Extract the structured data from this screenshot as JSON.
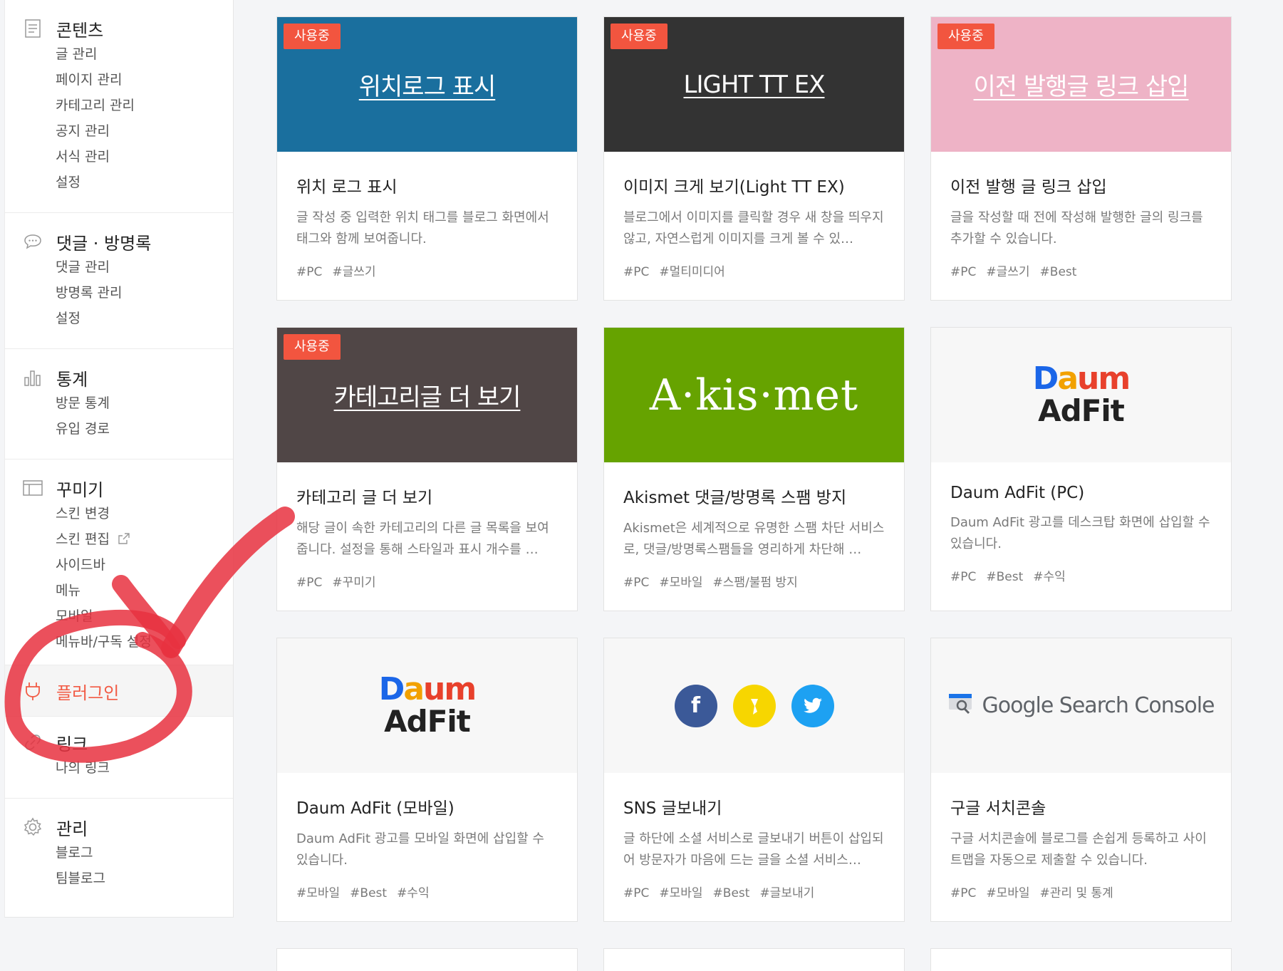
{
  "sidebar": {
    "content": {
      "title": "콘텐츠",
      "items": [
        "글 관리",
        "페이지 관리",
        "카테고리 관리",
        "공지 관리",
        "서식 관리",
        "설정"
      ]
    },
    "comments": {
      "title": "댓글 · 방명록",
      "items": [
        "댓글 관리",
        "방명록 관리",
        "설정"
      ]
    },
    "stats": {
      "title": "통계",
      "items": [
        "방문 통계",
        "유입 경로"
      ]
    },
    "design": {
      "title": "꾸미기",
      "items": [
        "스킨 변경",
        "스킨 편집",
        "사이드바",
        "메뉴",
        "모바일",
        "메뉴바/구독 설정"
      ]
    },
    "plugin": {
      "title": "플러그인"
    },
    "link": {
      "title": "링크",
      "items": [
        "나의 링크"
      ]
    },
    "manage": {
      "title": "관리",
      "items": [
        "블로그",
        "팀블로그"
      ]
    }
  },
  "cards": [
    {
      "badge": "사용중",
      "thumb_text": "위치로그 표시",
      "title": "위치 로그 표시",
      "desc": "글 작성 중 입력한 위치 태그를 블로그 화면에서 태그와 함께 보여줍니다.",
      "tags": [
        "#PC",
        "#글쓰기"
      ]
    },
    {
      "badge": "사용중",
      "thumb_text": "LIGHT TT EX",
      "title": "이미지 크게 보기(Light TT EX)",
      "desc": "블로그에서 이미지를 클릭할 경우 새 창을 띄우지 않고, 자연스럽게 이미지를 크게 볼 수 있…",
      "tags": [
        "#PC",
        "#멀티미디어"
      ]
    },
    {
      "badge": "사용중",
      "thumb_text": "이전 발행글 링크 삽입",
      "title": "이전 발행 글 링크 삽입",
      "desc": "글을 작성할 때 전에 작성해 발행한 글의 링크를 추가할 수 있습니다.",
      "tags": [
        "#PC",
        "#글쓰기",
        "#Best"
      ]
    },
    {
      "badge": "사용중",
      "thumb_text": "카테고리글 더 보기",
      "title": "카테고리 글 더 보기",
      "desc": "해당 글이 속한 카테고리의 다른 글 목록을 보여줍니다. 설정을 통해 스타일과 표시 개수를 …",
      "tags": [
        "#PC",
        "#꾸미기"
      ]
    },
    {
      "thumb_text": "A·kis·met",
      "title": "Akismet 댓글/방명록 스팸 방지",
      "desc": "Akismet은 세계적으로 유명한 스팸 차단 서비스로, 댓글/방명록스팸들을 영리하게 차단해 …",
      "tags": [
        "#PC",
        "#모바일",
        "#스팸/불펌 방지"
      ]
    },
    {
      "thumb_logo_top": "Daum",
      "thumb_logo_bottom": "AdFit",
      "title": "Daum AdFit (PC)",
      "desc": "Daum AdFit 광고를 데스크탑 화면에 삽입할 수 있습니다.",
      "tags": [
        "#PC",
        "#Best",
        "#수익"
      ]
    },
    {
      "thumb_logo_top": "Daum",
      "thumb_logo_bottom": "AdFit",
      "title": "Daum AdFit (모바일)",
      "desc": "Daum AdFit 광고를 모바일 화면에 삽입할 수 있습니다.",
      "tags": [
        "#모바일",
        "#Best",
        "#수익"
      ]
    },
    {
      "title": "SNS 글보내기",
      "desc": "글 하단에 소셜 서비스로 글보내기 버튼이 삽입되어 방문자가 마음에 드는 글을 소셜 서비스…",
      "tags": [
        "#PC",
        "#모바일",
        "#Best",
        "#글보내기"
      ]
    },
    {
      "thumb_text": "Google Search Console",
      "title": "구글 서치콘솔",
      "desc": "구글 서치콘솔에 블로그를 손쉽게 등록하고 사이트맵을 자동으로 제출할 수 있습니다.",
      "tags": [
        "#PC",
        "#모바일",
        "#관리 및 통계"
      ]
    }
  ],
  "colors": {
    "accent": "#f2553f",
    "annotation": "#e8313f"
  }
}
